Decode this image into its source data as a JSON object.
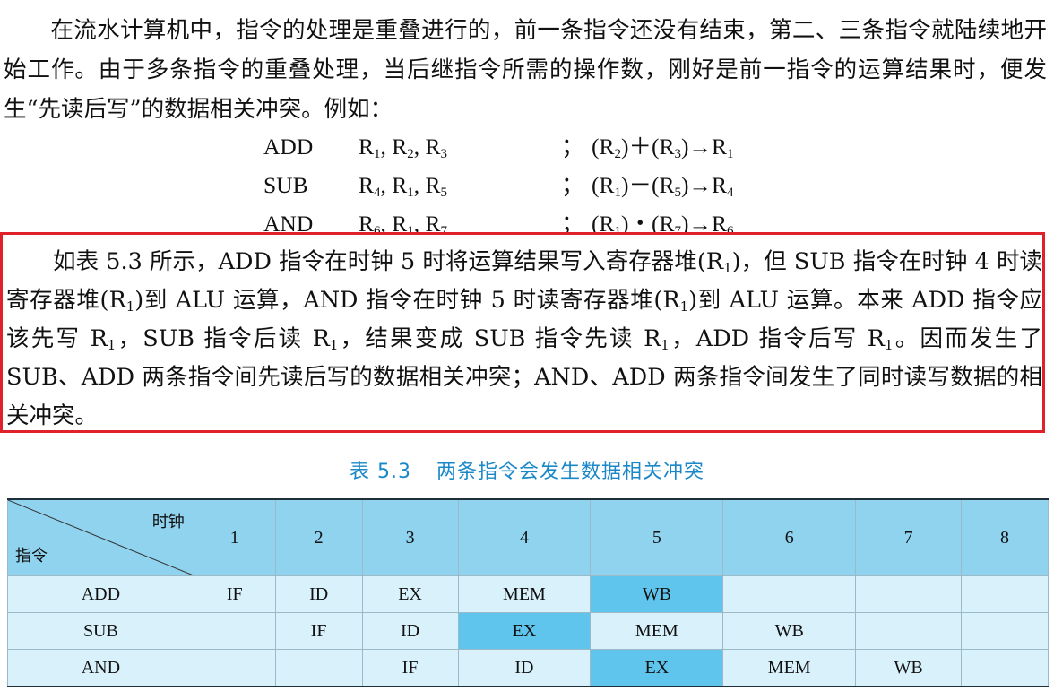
{
  "paragraph1": {
    "text_a": "在流水计算机中，指令的处理是重叠进行的，前一条指令还没有结束，第二、三条指令就陆续地开始工作。由于多条指令的重叠处理，当后继指令所需的操作数，刚好是前一指令的运算结果时，便发生“先读后写”的数据相关冲突。例如："
  },
  "code": [
    {
      "op": "ADD",
      "r1": "R",
      "s1": "1",
      "r2": "R",
      "s2": "2",
      "r3": "R",
      "s3": "3",
      "comment_a": "(R",
      "comment_s1": "2",
      "comment_b": ")＋(R",
      "comment_s2": "3",
      "comment_c": ")→R",
      "comment_s3": "1"
    },
    {
      "op": "SUB",
      "r1": "R",
      "s1": "4",
      "r2": "R",
      "s2": "1",
      "r3": "R",
      "s3": "5",
      "comment_a": "(R",
      "comment_s1": "1",
      "comment_b": ")－(R",
      "comment_s2": "5",
      "comment_c": ")→R",
      "comment_s3": "4"
    },
    {
      "op": "AND",
      "r1": "R",
      "s1": "6",
      "r2": "R",
      "s2": "1",
      "r3": "R",
      "s3": "7",
      "comment_a": "(R",
      "comment_s1": "1",
      "comment_b": ")・(R",
      "comment_s2": "7",
      "comment_c": ")→R",
      "comment_s3": "6"
    }
  ],
  "code_separator": "；",
  "paragraph2": {
    "p1": "如表 5.3 所示，ADD 指令在时钟 5 时将运算结果写入寄存器堆(R",
    "s1": "1",
    "p2": ")，但 SUB 指令在时钟 4 时读寄存器堆(R",
    "s2": "1",
    "p3": ")到 ALU 运算，AND 指令在时钟 5 时读寄存器堆(R",
    "s3": "1",
    "p4": ")到 ALU 运算。本来 ADD 指令应该先写 R",
    "s4": "1",
    "p5": "，SUB 指令后读 R",
    "s5": "1",
    "p6": "，结果变成 SUB 指令先读 R",
    "s6": "1",
    "p7": "，ADD 指令后写 R",
    "s7": "1",
    "p8": "。因而发生了 SUB、ADD 两条指令间先读后写的数据相关冲突；AND、ADD 两条指令间发生了同时读写数据的相关冲突。"
  },
  "table": {
    "caption_num": "表 5.3",
    "caption_text": "两条指令会发生数据相关冲突",
    "corner_top": "时钟",
    "corner_bottom": "指令",
    "clocks": [
      "1",
      "2",
      "3",
      "4",
      "5",
      "6",
      "7",
      "8"
    ],
    "rows": [
      {
        "name": "ADD",
        "cells": [
          "IF",
          "ID",
          "EX",
          "MEM",
          "WB",
          "",
          "",
          ""
        ],
        "highlight": [
          4
        ]
      },
      {
        "name": "SUB",
        "cells": [
          "",
          "IF",
          "ID",
          "EX",
          "MEM",
          "WB",
          "",
          ""
        ],
        "highlight": [
          3
        ]
      },
      {
        "name": "AND",
        "cells": [
          "",
          "",
          "IF",
          "ID",
          "EX",
          "MEM",
          "WB",
          ""
        ],
        "highlight": [
          4
        ]
      }
    ]
  },
  "colors": {
    "caption": "#1a88c8",
    "highlight_border": "#e0202a",
    "header_bg": "#8fd3ef",
    "cell_bg": "#d8f1fb",
    "cell_highlight": "#5fc5ec"
  }
}
